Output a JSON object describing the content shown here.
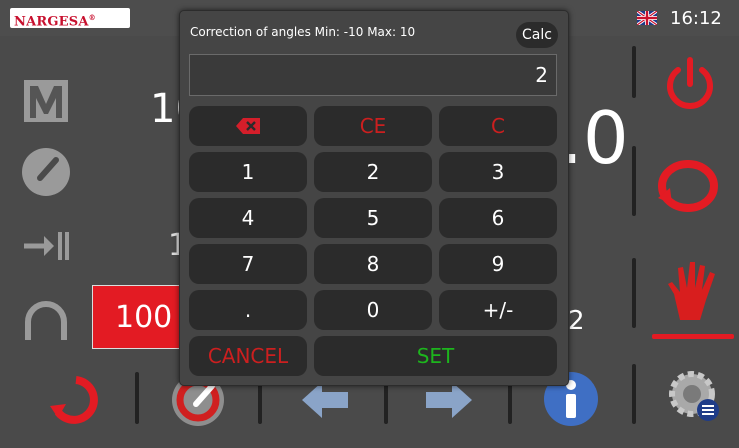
{
  "header": {
    "brand": "NARGESA",
    "time": "16:12",
    "language_flag": "uk-flag-icon"
  },
  "background": {
    "value_partial_top": "10",
    "big_value_partial": ".0",
    "value_partial_mid": "1",
    "value_partial_mid2": "1",
    "red_field_value": "100",
    "right_value_partial": "2"
  },
  "dialog": {
    "title": "Correction of angles Min: -10 Max: 10",
    "calc_label": "Calc",
    "display_value": "2",
    "keys": {
      "backspace": "backspace-icon",
      "ce": "CE",
      "c": "C",
      "k1": "1",
      "k2": "2",
      "k3": "3",
      "k4": "4",
      "k5": "5",
      "k6": "6",
      "k7": "7",
      "k8": "8",
      "k9": "9",
      "dot": ".",
      "k0": "0",
      "plusminus": "+/-",
      "cancel": "CANCEL",
      "set": "SET"
    }
  },
  "colors": {
    "accent_red": "#e31b23",
    "set_green": "#1db51d",
    "key_bg": "#2b2b2b",
    "panel_bg": "#4a4a4a"
  }
}
